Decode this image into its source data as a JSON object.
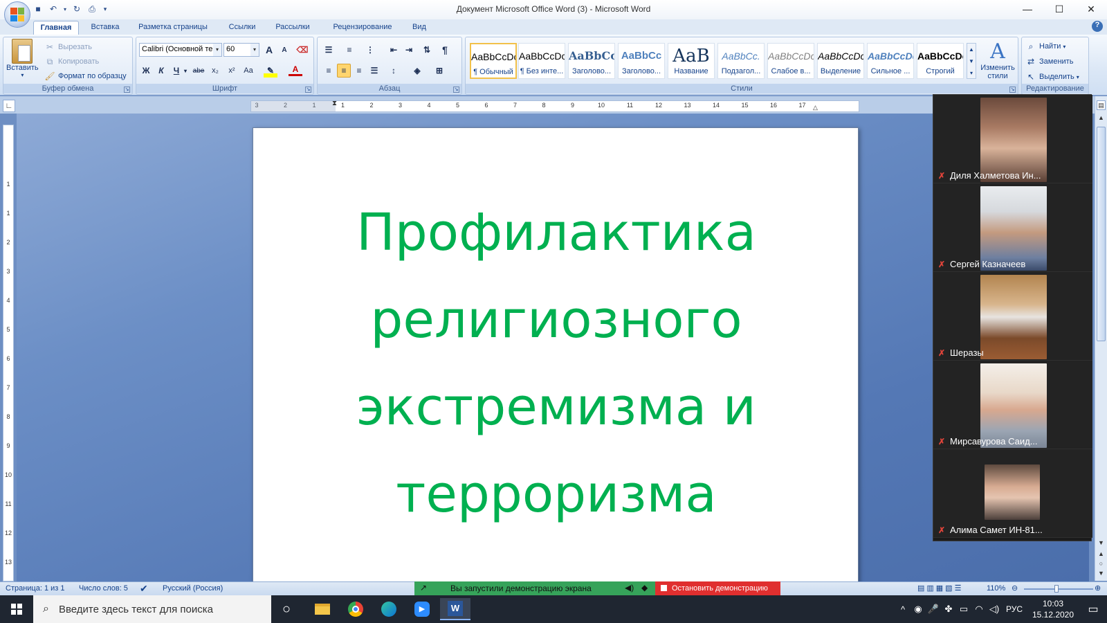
{
  "window": {
    "title": "Документ Microsoft Office Word (3) - Microsoft Word",
    "controls": {
      "minimize": "—",
      "maximize": "☐",
      "close": "✕"
    }
  },
  "qat": {
    "save_icon": "save-icon",
    "undo_icon": "undo-icon",
    "redo_icon": "redo-icon",
    "print_icon": "quick-print-icon"
  },
  "tabs": [
    "Главная",
    "Вставка",
    "Разметка страницы",
    "Ссылки",
    "Рассылки",
    "Рецензирование",
    "Вид"
  ],
  "active_tab": "Главная",
  "ribbon": {
    "clipboard": {
      "label": "Буфер обмена",
      "paste": "Вставить",
      "cut": "Вырезать",
      "copy": "Копировать",
      "format_painter": "Формат по образцу"
    },
    "font": {
      "label": "Шрифт",
      "font_name": "Calibri (Основной те",
      "font_size": "60",
      "grow": "A",
      "shrink": "A",
      "bold": "Ж",
      "italic": "К",
      "underline": "Ч",
      "strike": "abe",
      "subscript": "x₂",
      "superscript": "x²",
      "change_case": "Aa",
      "font_color_letter": "A"
    },
    "paragraph": {
      "label": "Абзац",
      "pilcrow": "¶"
    },
    "styles": {
      "label": "Стили",
      "items": [
        {
          "preview": "AaBbCcDc",
          "label": "¶ Обычный",
          "selected": true
        },
        {
          "preview": "AaBbCcDc",
          "label": "¶ Без инте...",
          "selected": false
        },
        {
          "preview": "AaBbCc",
          "label": "Заголово...",
          "selected": false
        },
        {
          "preview": "AaBbCc",
          "label": "Заголово...",
          "selected": false
        },
        {
          "preview": "AaB",
          "label": "Название",
          "selected": false
        },
        {
          "preview": "AaBbCc.",
          "label": "Подзагол...",
          "selected": false
        },
        {
          "preview": "AaBbCcDc",
          "label": "Слабое в...",
          "selected": false
        },
        {
          "preview": "AaBbCcDc",
          "label": "Выделение",
          "selected": false
        },
        {
          "preview": "AaBbCcDc",
          "label": "Сильное ...",
          "selected": false
        },
        {
          "preview": "AaBbCcDc",
          "label": "Строгий",
          "selected": false
        }
      ],
      "change_styles": "Изменить стили"
    },
    "editing": {
      "label": "Редактирование",
      "find": "Найти",
      "replace": "Заменить",
      "select": "Выделить"
    }
  },
  "ruler": {
    "h_ticks": [
      "3",
      "2",
      "1",
      "1",
      "2",
      "3",
      "4",
      "5",
      "6",
      "7",
      "8",
      "9",
      "10",
      "11",
      "12",
      "13",
      "14",
      "15",
      "16",
      "17"
    ],
    "v_ticks": [
      "1",
      "1",
      "2",
      "3",
      "4",
      "5",
      "6",
      "7",
      "8",
      "9",
      "10",
      "11",
      "12",
      "13"
    ]
  },
  "document": {
    "lines": [
      "Профилактика",
      "религиозного",
      "экстремизма и",
      "терроризма"
    ],
    "text_color": "#00b050"
  },
  "participants": [
    {
      "name": "Диля Халметова Ин...",
      "muted": true
    },
    {
      "name": "Сергей Казначеев",
      "muted": true
    },
    {
      "name": "Шеразы",
      "muted": true
    },
    {
      "name": "Мирсавурова Саид...",
      "muted": true
    },
    {
      "name": "Алима Самет ИН-81...",
      "muted": true
    }
  ],
  "statusbar": {
    "page": "Страница: 1 из 1",
    "words": "Число слов: 5",
    "language": "Русский (Россия)",
    "zoom": "110%"
  },
  "screenshare": {
    "status": "Вы запустили демонстрацию экрана",
    "stop": "Остановить демонстрацию"
  },
  "taskbar": {
    "search_placeholder": "Введите здесь текст для поиска",
    "language": "РУС",
    "time": "10:03",
    "date": "15.12.2020"
  }
}
